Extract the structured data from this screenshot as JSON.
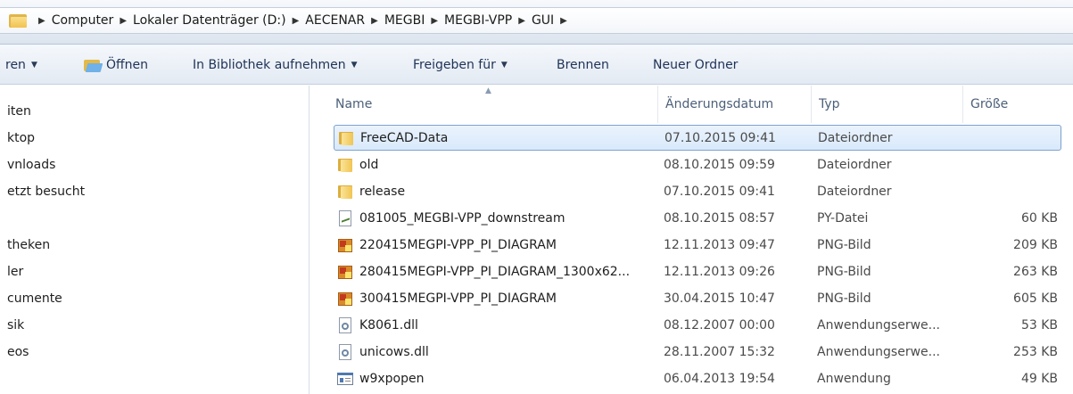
{
  "breadcrumb": {
    "items": [
      "Computer",
      "Lokaler Datenträger (D:)",
      "AECENAR",
      "MEGBI",
      "MEGBI-VPP",
      "GUI"
    ]
  },
  "toolbar": {
    "organize_label": "ren",
    "open_label": "Öffnen",
    "library_label": "In Bibliothek aufnehmen",
    "share_label": "Freigeben für",
    "burn_label": "Brennen",
    "new_folder_label": "Neuer Ordner"
  },
  "nav": {
    "items": [
      "iten",
      "ktop",
      "vnloads",
      "etzt besucht",
      "theken",
      "ler",
      "cumente",
      "sik",
      "eos"
    ]
  },
  "columns": {
    "name": "Name",
    "date": "Änderungsdatum",
    "type": "Typ",
    "size": "Größe"
  },
  "files": [
    {
      "name": "FreeCAD-Data",
      "date": "07.10.2015 09:41",
      "type": "Dateiordner",
      "size": "",
      "icon": "folder-icon",
      "selected": true
    },
    {
      "name": "old",
      "date": "08.10.2015 09:59",
      "type": "Dateiordner",
      "size": "",
      "icon": "folder-icon"
    },
    {
      "name": "release",
      "date": "07.10.2015 09:41",
      "type": "Dateiordner",
      "size": "",
      "icon": "folder-icon"
    },
    {
      "name": "081005_MEGBI-VPP_downstream",
      "date": "08.10.2015 08:57",
      "type": "PY-Datei",
      "size": "60 KB",
      "icon": "python-file-icon"
    },
    {
      "name": "220415MEGPI-VPP_PI_DIAGRAM",
      "date": "12.11.2013 09:47",
      "type": "PNG-Bild",
      "size": "209 KB",
      "icon": "png-image-icon"
    },
    {
      "name": "280415MEGPI-VPP_PI_DIAGRAM_1300x62...",
      "date": "12.11.2013 09:26",
      "type": "PNG-Bild",
      "size": "263 KB",
      "icon": "png-image-icon"
    },
    {
      "name": "300415MEGPI-VPP_PI_DIAGRAM",
      "date": "30.04.2015 10:47",
      "type": "PNG-Bild",
      "size": "605 KB",
      "icon": "png-image-icon"
    },
    {
      "name": "K8061.dll",
      "date": "08.12.2007 00:00",
      "type": "Anwendungserwe...",
      "size": "53 KB",
      "icon": "dll-file-icon"
    },
    {
      "name": "unicows.dll",
      "date": "28.11.2007 15:32",
      "type": "Anwendungserwe...",
      "size": "253 KB",
      "icon": "dll-file-icon"
    },
    {
      "name": "w9xpopen",
      "date": "06.04.2013 19:54",
      "type": "Anwendung",
      "size": "49 KB",
      "icon": "application-icon"
    }
  ]
}
